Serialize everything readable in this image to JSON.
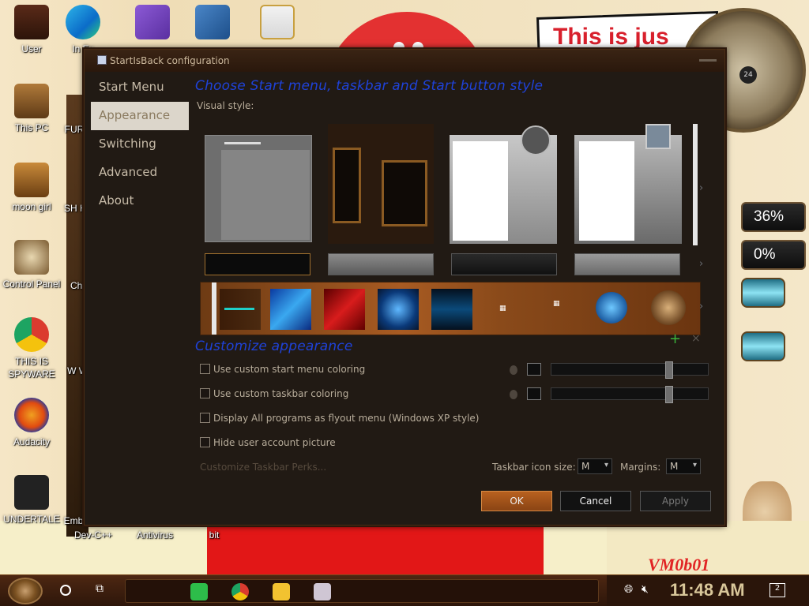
{
  "desktop": {
    "sign_text": "This is jus",
    "percent_top": "36%",
    "percent_bottom": "0%",
    "watermark": "VM0b01",
    "clock_dial_number": "24",
    "icons": [
      {
        "label": "User"
      },
      {
        "label": "This PC"
      },
      {
        "label": "moon girl"
      },
      {
        "label": "Control Panel"
      },
      {
        "label": "THIS IS SPYWARE"
      },
      {
        "label": "Audacity"
      },
      {
        "label": "UNDERTALE"
      }
    ],
    "partial_labels": {
      "in_ex": "In Ex",
      "fur": "FUR U",
      "sh_ho": "SH HO",
      "cho": "Cho",
      "w_wr": "W Wr",
      "emb": "Emb",
      "dev_cpp": "Dev-C++",
      "antivirus": "Antivirus",
      "bit": "bit"
    }
  },
  "dialog": {
    "title": "StartIsBack configuration",
    "nav": [
      {
        "label": "Start Menu"
      },
      {
        "label": "Appearance"
      },
      {
        "label": "Switching"
      },
      {
        "label": "Advanced"
      },
      {
        "label": "About"
      }
    ],
    "active_nav": "Appearance",
    "section1_title": "Choose Start menu, taskbar and Start button style",
    "visual_style_label": "Visual style:",
    "section2_title": "Customize appearance",
    "options": [
      {
        "label": "Use custom start menu coloring",
        "checked": false
      },
      {
        "label": "Use custom taskbar coloring",
        "checked": false
      },
      {
        "label": "Display All programs as flyout menu (Windows XP style)",
        "checked": false
      },
      {
        "label": "Hide user account picture",
        "checked": false
      }
    ],
    "customize_perks": "Customize Taskbar Perks...",
    "taskbar_icon_size_label": "Taskbar icon size:",
    "taskbar_icon_size_value": "M",
    "margins_label": "Margins:",
    "margins_value": "M",
    "buttons": {
      "ok": "OK",
      "cancel": "Cancel",
      "apply": "Apply"
    }
  },
  "taskbar": {
    "time": "11:48 AM",
    "notification_count": "2"
  },
  "colors": {
    "accent_title": "#1f42d8",
    "ok_button": "#b8611f",
    "dialog_bg": "#211a14"
  }
}
